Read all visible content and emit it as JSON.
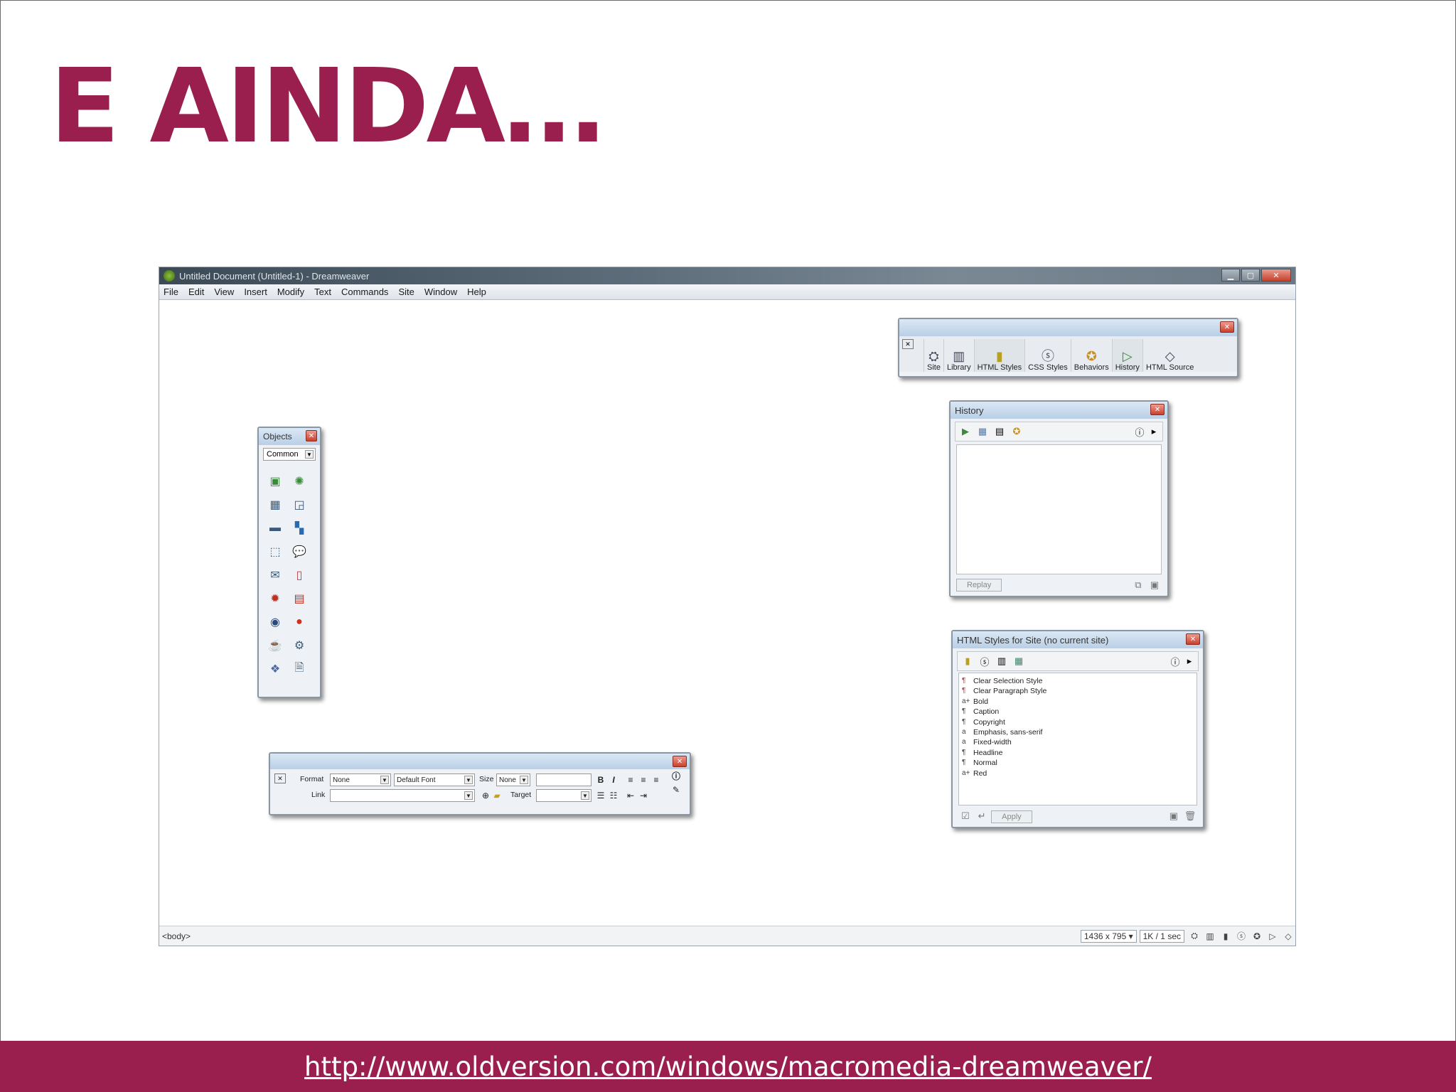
{
  "slide": {
    "title": "E AINDA…",
    "footer_link": "http://www.oldversion.com/windows/macromedia-dreamweaver/",
    "accent": "#9b1f4e"
  },
  "app": {
    "window_title": "Untitled Document (Untitled-1) - Dreamweaver",
    "menu": [
      "File",
      "Edit",
      "View",
      "Insert",
      "Modify",
      "Text",
      "Commands",
      "Site",
      "Window",
      "Help"
    ],
    "status": {
      "tag": "<body>",
      "size": "1436 x 795 ▾",
      "download": "1K / 1 sec"
    }
  },
  "launcher": {
    "items": [
      "Site",
      "Library",
      "HTML Styles",
      "CSS Styles",
      "Behaviors",
      "History",
      "HTML Source"
    ]
  },
  "history": {
    "title": "History",
    "replay": "Replay"
  },
  "objects": {
    "title": "Objects",
    "category": "Common"
  },
  "styles": {
    "title": "HTML Styles for Site (no current site)",
    "items": [
      {
        "mark": "¶",
        "label": "Clear Selection Style"
      },
      {
        "mark": "¶",
        "label": "Clear Paragraph Style"
      },
      {
        "mark": "a+",
        "label": "Bold"
      },
      {
        "mark": "¶",
        "label": "Caption"
      },
      {
        "mark": "¶",
        "label": "Copyright"
      },
      {
        "mark": "a",
        "label": "Emphasis, sans-serif"
      },
      {
        "mark": "a",
        "label": "Fixed-width"
      },
      {
        "mark": "¶",
        "label": "Headline"
      },
      {
        "mark": "¶",
        "label": "Normal"
      },
      {
        "mark": "a+",
        "label": "Red"
      }
    ],
    "apply": "Apply"
  },
  "properties": {
    "format_label": "Format",
    "format_value": "None",
    "font_value": "Default Font",
    "size_label": "Size",
    "size_value": "None",
    "link_label": "Link",
    "target_label": "Target",
    "bold": "B",
    "italic": "I"
  }
}
